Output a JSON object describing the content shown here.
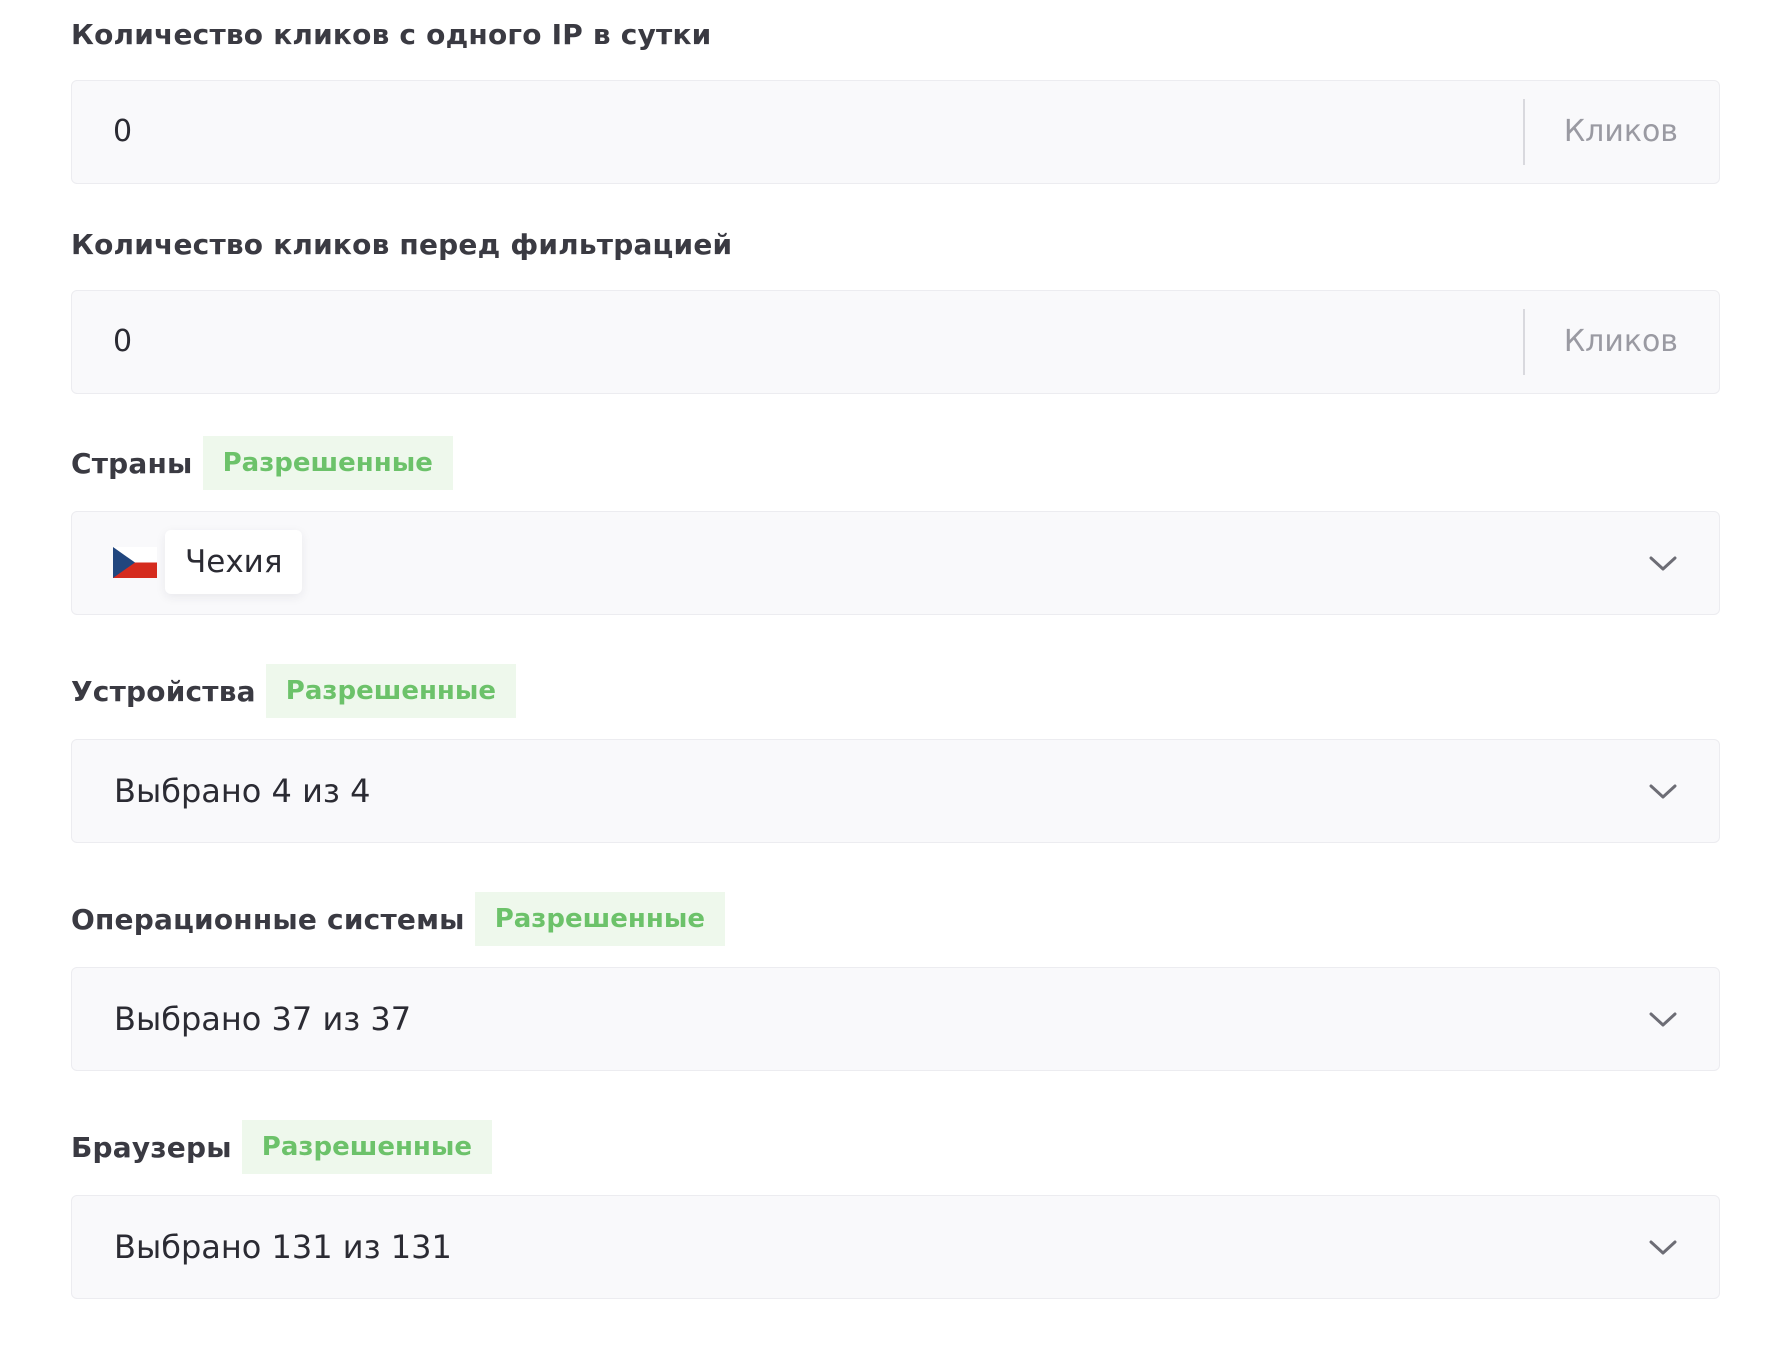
{
  "clicks_per_ip": {
    "label": "Количество кликов с одного IP в сутки",
    "value": "0",
    "suffix": "Кликов"
  },
  "clicks_before_filter": {
    "label": "Количество кликов перед фильтрацией",
    "value": "0",
    "suffix": "Кликов"
  },
  "countries": {
    "label": "Страны",
    "mode": "Разрешенные",
    "selected": [
      {
        "name": "Чехия",
        "flag_icon": "czech-flag-icon"
      }
    ]
  },
  "devices": {
    "label": "Устройства",
    "mode": "Разрешенные",
    "summary": "Выбрано 4 из 4"
  },
  "os": {
    "label": "Операционные системы",
    "mode": "Разрешенные",
    "summary": "Выбрано 37 из 37"
  },
  "browsers": {
    "label": "Браузеры",
    "mode": "Разрешенные",
    "summary": "Выбрано 131 из 131"
  },
  "colors": {
    "badge_text": "#6cc26a",
    "badge_bg": "#eef8ec",
    "field_bg": "#f9f9fb"
  }
}
